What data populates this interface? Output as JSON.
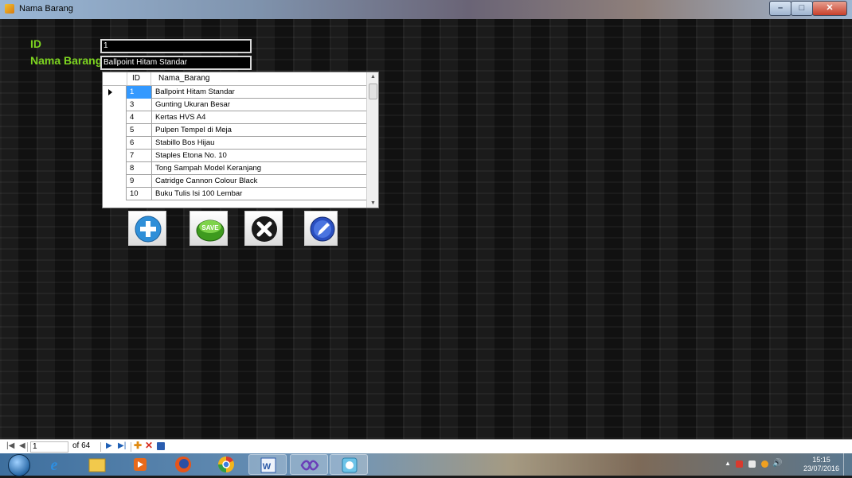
{
  "window": {
    "title": "Nama Barang"
  },
  "form": {
    "id_label": "ID",
    "id_value": "1",
    "nama_label": "Nama Barang",
    "nama_value": "Ballpoint Hitam Standar"
  },
  "grid": {
    "columns": [
      "ID",
      "Nama_Barang"
    ],
    "rows": [
      {
        "id": "1",
        "nama": "Ballpoint Hitam Standar"
      },
      {
        "id": "3",
        "nama": "Gunting Ukuran Besar"
      },
      {
        "id": "4",
        "nama": "Kertas HVS A4"
      },
      {
        "id": "5",
        "nama": "Pulpen Tempel di Meja"
      },
      {
        "id": "6",
        "nama": "Stabillo Bos Hijau"
      },
      {
        "id": "7",
        "nama": "Staples Etona No. 10"
      },
      {
        "id": "8",
        "nama": "Tong Sampah Model Keranjang"
      },
      {
        "id": "9",
        "nama": "Catridge Cannon Colour Black"
      },
      {
        "id": "10",
        "nama": "Buku Tulis Isi 100 Lembar"
      }
    ]
  },
  "buttons": {
    "save_text": "SAVE"
  },
  "navigator": {
    "position": "1",
    "of_count": "of 64"
  },
  "taskbar": {
    "time": "15:15",
    "date": "23/07/2016"
  },
  "colors": {
    "label_green": "#7dd420",
    "selection_blue": "#3399ff"
  }
}
